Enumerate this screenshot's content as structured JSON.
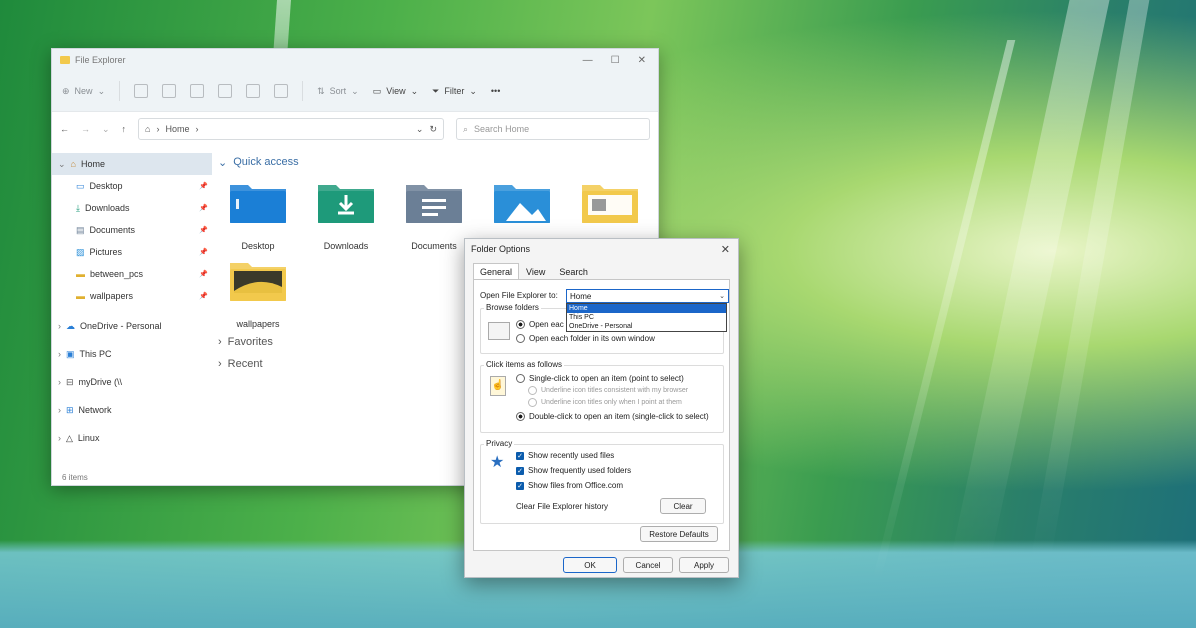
{
  "explorer": {
    "title": "File Explorer",
    "toolbar": {
      "new_label": "New",
      "sort_label": "Sort",
      "view_label": "View",
      "filter_label": "Filter",
      "more_label": "•••"
    },
    "address": {
      "crumb": "Home",
      "search_placeholder": "Search Home"
    },
    "nav": [
      {
        "label": "Home",
        "icon": "home-icon",
        "pinned": false
      },
      {
        "label": "Desktop",
        "icon": "desktop-icon",
        "pinned": true
      },
      {
        "label": "Downloads",
        "icon": "download-icon",
        "pinned": true
      },
      {
        "label": "Documents",
        "icon": "document-icon",
        "pinned": true
      },
      {
        "label": "Pictures",
        "icon": "pictures-icon",
        "pinned": true
      },
      {
        "label": "between_pcs",
        "icon": "folder-icon",
        "pinned": true
      },
      {
        "label": "wallpapers",
        "icon": "folder-icon",
        "pinned": true
      },
      {
        "label": "OneDrive - Personal",
        "icon": "cloud-icon",
        "pinned": false
      },
      {
        "label": "This PC",
        "icon": "pc-icon",
        "pinned": false
      },
      {
        "label": "myDrive (\\\\",
        "icon": "network-drive-icon",
        "pinned": false
      },
      {
        "label": "Network",
        "icon": "network-icon",
        "pinned": false
      },
      {
        "label": "Linux",
        "icon": "linux-icon",
        "pinned": false
      }
    ],
    "sections": {
      "quick_access": "Quick access",
      "favorites": "Favorites",
      "recent": "Recent"
    },
    "folders": [
      {
        "label": "Desktop",
        "color": "#1b7fd6"
      },
      {
        "label": "Downloads",
        "color": "#1e9a7a"
      },
      {
        "label": "Documents",
        "color": "#6b7f96"
      },
      {
        "label": "Pictures",
        "color": "#2a8fd8"
      },
      {
        "label": "",
        "color": "#f2c94c"
      }
    ],
    "folders_row2": [
      {
        "label": "wallpapers",
        "color": "#f2c94c"
      }
    ],
    "status": "6 items"
  },
  "dialog": {
    "title": "Folder Options",
    "close": "✕",
    "tabs": [
      "General",
      "View",
      "Search"
    ],
    "open_to_label": "Open File Explorer to:",
    "open_to_value": "Home",
    "open_to_options": [
      "Home",
      "This PC",
      "OneDrive - Personal"
    ],
    "browse_folders": {
      "label": "Browse folders",
      "opt1": "Open eac",
      "opt2": "Open each folder in its own window"
    },
    "click_items": {
      "label": "Click items as follows",
      "opt1": "Single-click to open an item (point to select)",
      "sub1": "Underline icon titles consistent with my browser",
      "sub2": "Underline icon titles only when I point at them",
      "opt2": "Double-click to open an item (single-click to select)"
    },
    "privacy": {
      "label": "Privacy",
      "c1": "Show recently used files",
      "c2": "Show frequently used folders",
      "c3": "Show files from Office.com",
      "clear_label": "Clear File Explorer history",
      "clear_btn": "Clear"
    },
    "restore_btn": "Restore Defaults",
    "ok": "OK",
    "cancel": "Cancel",
    "apply": "Apply"
  }
}
